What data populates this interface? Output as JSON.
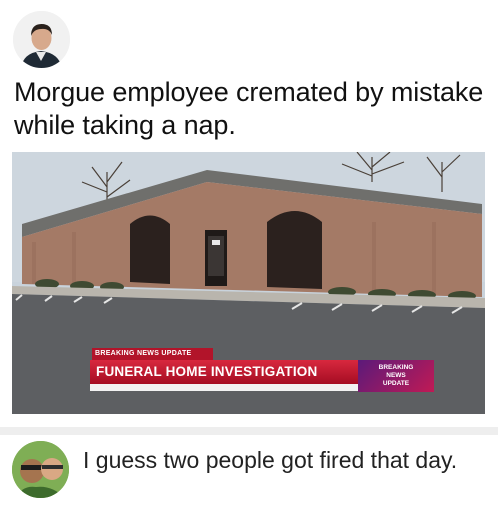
{
  "post": {
    "caption": "Morgue employee cremated by mistake while taking a nap."
  },
  "news_overlay": {
    "kicker": "BREAKING NEWS UPDATE",
    "headline": "FUNERAL HOME INVESTIGATION",
    "badge_line1": "BREAKING",
    "badge_line2": "NEWS",
    "badge_line3": "UPDATE"
  },
  "comment": {
    "text": "I guess two people got fired that day."
  },
  "colors": {
    "accent_red": "#b2142a",
    "brick": "#a47a66"
  }
}
